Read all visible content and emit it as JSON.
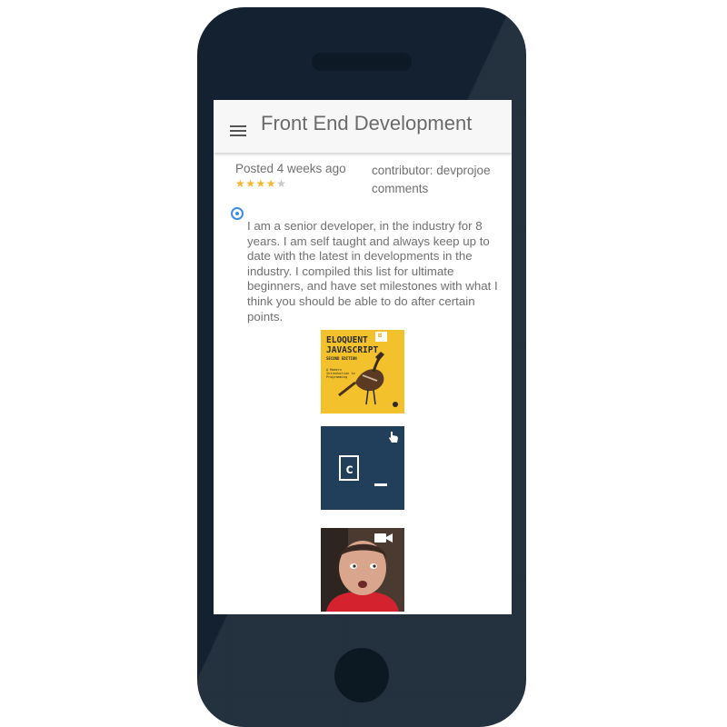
{
  "app": {
    "title": "Front End Development",
    "menu_icon": "hamburger-menu-icon"
  },
  "post": {
    "posted": "Posted 4 weeks ago",
    "rating": 4,
    "rating_max": 5,
    "contributor": "contributor: devprojoe",
    "comments": "comments",
    "description": "I am a senior developer, in the industry for 8 years. I am self taught and always keep up to date with the latest in developments in the industry. I compiled this list for ultimate beginners, and have set milestones with what I think you should be able to do after certain points."
  },
  "resources": {
    "book": {
      "title_line1": "ELOQUENT",
      "title_line2": "JAVASCRIPT",
      "edition": "SECOND EDITION",
      "subtitle": "A Modern Introduction to Programming",
      "corner_badge": "B"
    },
    "codecademy": {
      "icon": "codecademy-logo-icon",
      "badge_icon": "pointer-hand-icon"
    },
    "video": {
      "icon": "video-thumbnail",
      "badge_icon": "video-camera-icon"
    }
  },
  "colors": {
    "phone_body": "#132130",
    "accent_blue": "#3b8de8",
    "star_filled": "#f5b731",
    "star_empty": "#c8c8c8",
    "book_yellow": "#f3c12b",
    "codecademy_navy": "#213f5a"
  }
}
